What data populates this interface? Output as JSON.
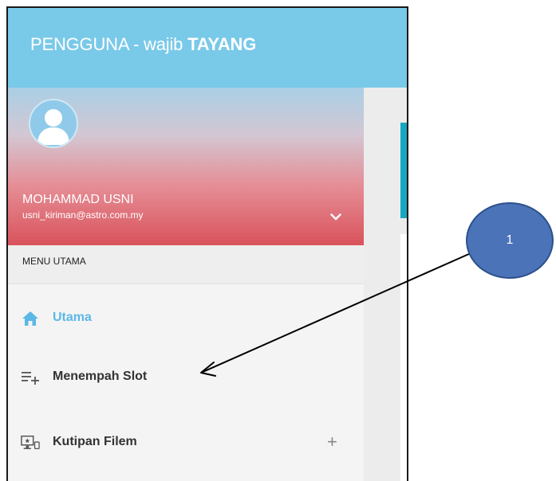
{
  "app": {
    "title_prefix": "PENGGUNA - wajib ",
    "title_bold": "TAYANG",
    "header_color": "#79c9e9"
  },
  "user": {
    "name": "MOHAMMAD USNI",
    "email": "usni_kiriman@astro.com.my",
    "avatar_icon": "user-avatar-icon",
    "expand_icon": "chevron-down-icon"
  },
  "menu": {
    "header": "MENU UTAMA",
    "items": [
      {
        "label": "Utama",
        "icon": "home-icon",
        "active": true,
        "color": "#5bb8e6"
      },
      {
        "label": "Menempah Slot",
        "icon": "playlist-add-icon",
        "active": false
      },
      {
        "label": "Kutipan Filem",
        "icon": "film-screen-icon",
        "active": false,
        "expand": "+"
      }
    ]
  },
  "annotation": {
    "number": "1",
    "color": "#4a73b8"
  }
}
